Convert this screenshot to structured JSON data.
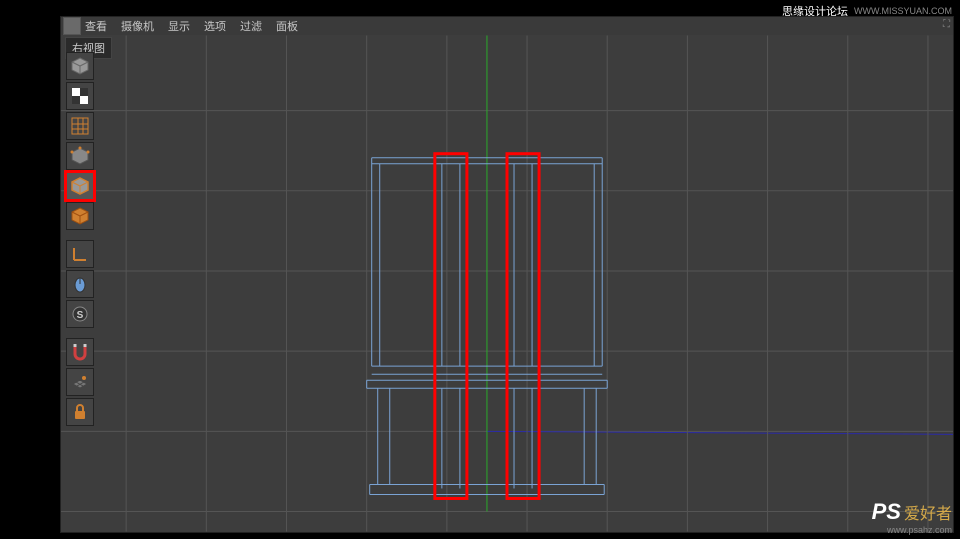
{
  "watermark_top": {
    "text": "思缘设计论坛",
    "url": "WWW.MISSYUAN.COM"
  },
  "watermark_bottom": {
    "ps": "PS",
    "text": "爱好者",
    "url": "www.psahz.com"
  },
  "menubar": {
    "items": [
      "查看",
      "摄像机",
      "显示",
      "选项",
      "过滤",
      "面板"
    ]
  },
  "viewport": {
    "label": "右视图"
  },
  "tools": [
    {
      "name": "model-mode",
      "icon": "cube-gray"
    },
    {
      "name": "texture-mode",
      "icon": "checker"
    },
    {
      "name": "uv-mode",
      "icon": "grid-orange"
    },
    {
      "name": "point-mode",
      "icon": "cube-points"
    },
    {
      "name": "edge-mode",
      "icon": "cube-edge",
      "selected": true
    },
    {
      "name": "polygon-mode",
      "icon": "cube-face"
    },
    {
      "name": "axis-mode",
      "icon": "axis"
    },
    {
      "name": "mouse-mode",
      "icon": "mouse"
    },
    {
      "name": "snap-s",
      "icon": "s-circle"
    },
    {
      "name": "magnet-mode",
      "icon": "magnet"
    },
    {
      "name": "workplane-mode",
      "icon": "workplane"
    },
    {
      "name": "lock-mode",
      "icon": "lock"
    }
  ]
}
